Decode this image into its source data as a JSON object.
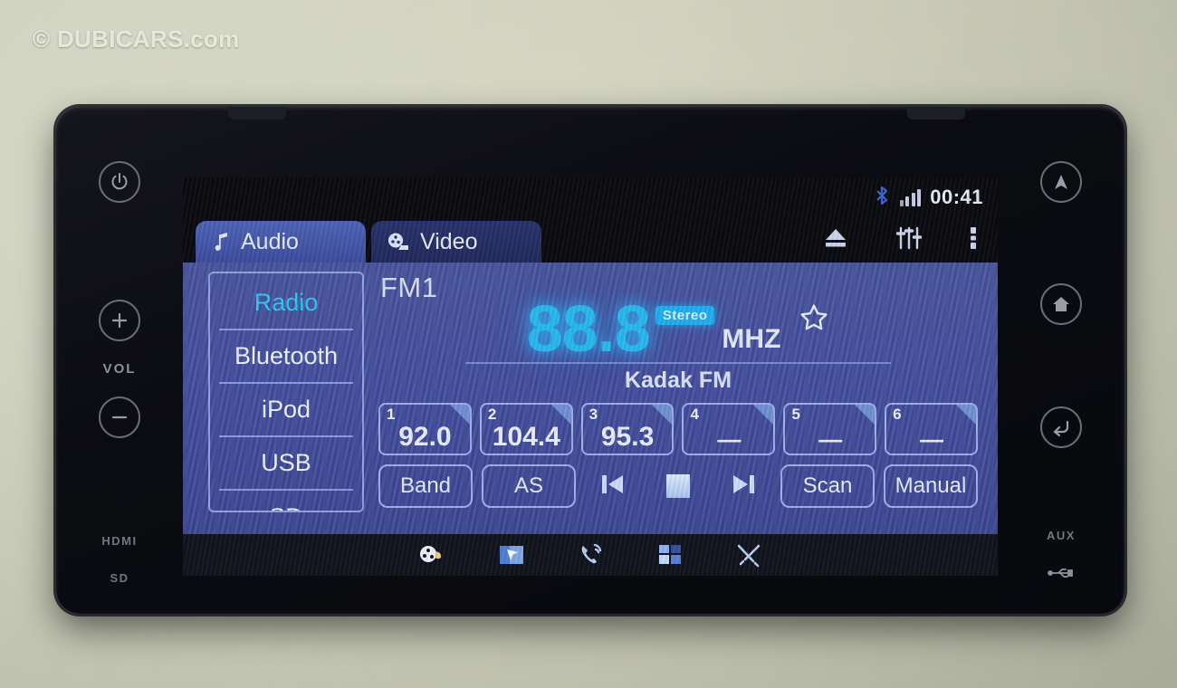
{
  "watermark": "© DUBICARS.com",
  "status": {
    "bluetooth_icon": "bluetooth-icon",
    "signal_icon": "signal-bars-icon",
    "time": "00:41"
  },
  "tabs": [
    {
      "label": "Audio",
      "icon": "music-note-icon",
      "active": true
    },
    {
      "label": "Video",
      "icon": "film-reel-icon",
      "active": false
    }
  ],
  "top_actions": [
    {
      "name": "eject-icon",
      "label": "Eject"
    },
    {
      "name": "equalizer-icon",
      "label": "Equalizer"
    },
    {
      "name": "more-options-icon",
      "label": "More"
    }
  ],
  "sources": [
    {
      "label": "Radio",
      "active": true
    },
    {
      "label": "Bluetooth",
      "active": false
    },
    {
      "label": "iPod",
      "active": false
    },
    {
      "label": "USB",
      "active": false
    },
    {
      "label": "SD",
      "active": false
    }
  ],
  "tuner": {
    "band": "FM1",
    "frequency": "88.8",
    "unit": "MHZ",
    "stereo_badge": "Stereo",
    "favorite_icon": "star-outline-icon",
    "station": "Kadak FM"
  },
  "presets": [
    {
      "num": "1",
      "value": "92.0",
      "empty": false
    },
    {
      "num": "2",
      "value": "104.4",
      "empty": false
    },
    {
      "num": "3",
      "value": "95.3",
      "empty": false
    },
    {
      "num": "4",
      "value": "—",
      "empty": true
    },
    {
      "num": "5",
      "value": "—",
      "empty": true
    },
    {
      "num": "6",
      "value": "—",
      "empty": true
    }
  ],
  "transport": {
    "band_button": "Band",
    "as_button": "AS",
    "prev_icon": "previous-track-icon",
    "stop_icon": "stop-icon",
    "next_icon": "next-track-icon",
    "scan_button": "Scan",
    "manual_button": "Manual"
  },
  "dock": [
    {
      "name": "media-icon",
      "label": "Media"
    },
    {
      "name": "navigation-icon",
      "label": "Navigation"
    },
    {
      "name": "phone-icon",
      "label": "Phone"
    },
    {
      "name": "apps-grid-icon",
      "label": "Apps"
    },
    {
      "name": "tools-settings-icon",
      "label": "Settings"
    }
  ],
  "bezel": {
    "left": {
      "power_icon": "power-icon",
      "volume_up_icon": "plus-icon",
      "volume_label": "VOL",
      "volume_down_icon": "minus-icon",
      "hdmi_label": "HDMI",
      "sd_label": "SD"
    },
    "right": {
      "navigation_icon": "nav-arrow-icon",
      "home_icon": "home-icon",
      "back_icon": "back-return-icon",
      "aux_label": "AUX",
      "usb_icon": "usb-icon"
    }
  },
  "colors": {
    "accent_cyan": "#2fc8f5",
    "panel_blue": "#444fa0",
    "tab_active": "#4f63b8",
    "bezel_black": "#0b0c11"
  }
}
